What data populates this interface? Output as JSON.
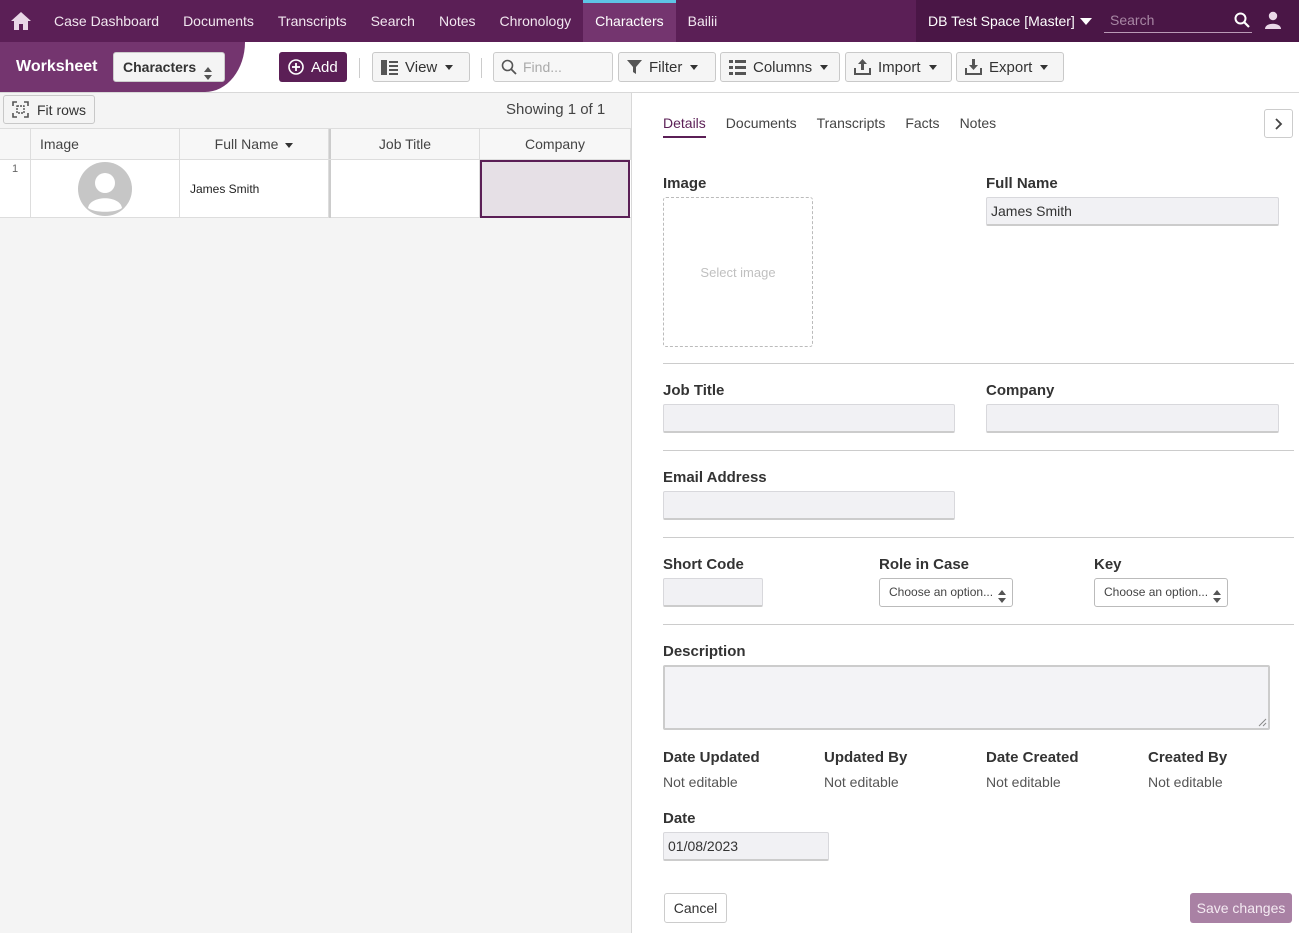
{
  "nav": {
    "items": [
      "Case Dashboard",
      "Documents",
      "Transcripts",
      "Search",
      "Notes",
      "Chronology",
      "Characters",
      "Bailii"
    ],
    "active_index": 6,
    "space_name": "DB Test Space [Master]",
    "search_placeholder": "Search",
    "accent_color": "#5b1f56"
  },
  "toolbar": {
    "worksheet_label": "Worksheet",
    "sheet_select": "Characters",
    "add_label": "Add",
    "view_label": "View",
    "find_placeholder": "Find...",
    "filter_label": "Filter",
    "columns_label": "Columns",
    "import_label": "Import",
    "export_label": "Export"
  },
  "grid": {
    "fit_rows_label": "Fit rows",
    "showing_text": "Showing 1 of 1",
    "columns": [
      "Image",
      "Full Name",
      "Job Title",
      "Company"
    ],
    "sorted_column": "Full Name",
    "rows": [
      {
        "num": "1",
        "full_name": "James Smith",
        "job_title": "",
        "company": ""
      }
    ]
  },
  "detail": {
    "tabs": [
      "Details",
      "Documents",
      "Transcripts",
      "Facts",
      "Notes"
    ],
    "active_tab": "Details",
    "image_label": "Image",
    "select_image": "Select image",
    "full_name_label": "Full Name",
    "full_name_value": "James Smith",
    "job_title_label": "Job Title",
    "job_title_value": "",
    "company_label": "Company",
    "company_value": "",
    "email_label": "Email Address",
    "email_value": "",
    "short_code_label": "Short Code",
    "role_label": "Role in Case",
    "role_value": "Choose an option...",
    "key_label": "Key",
    "key_value": "Choose an option...",
    "description_label": "Description",
    "date_updated_label": "Date Updated",
    "updated_by_label": "Updated By",
    "date_created_label": "Date Created",
    "created_by_label": "Created By",
    "not_editable": "Not editable",
    "date_label": "Date",
    "date_value": "01/08/2023",
    "cancel_label": "Cancel",
    "save_label": "Save changes"
  }
}
